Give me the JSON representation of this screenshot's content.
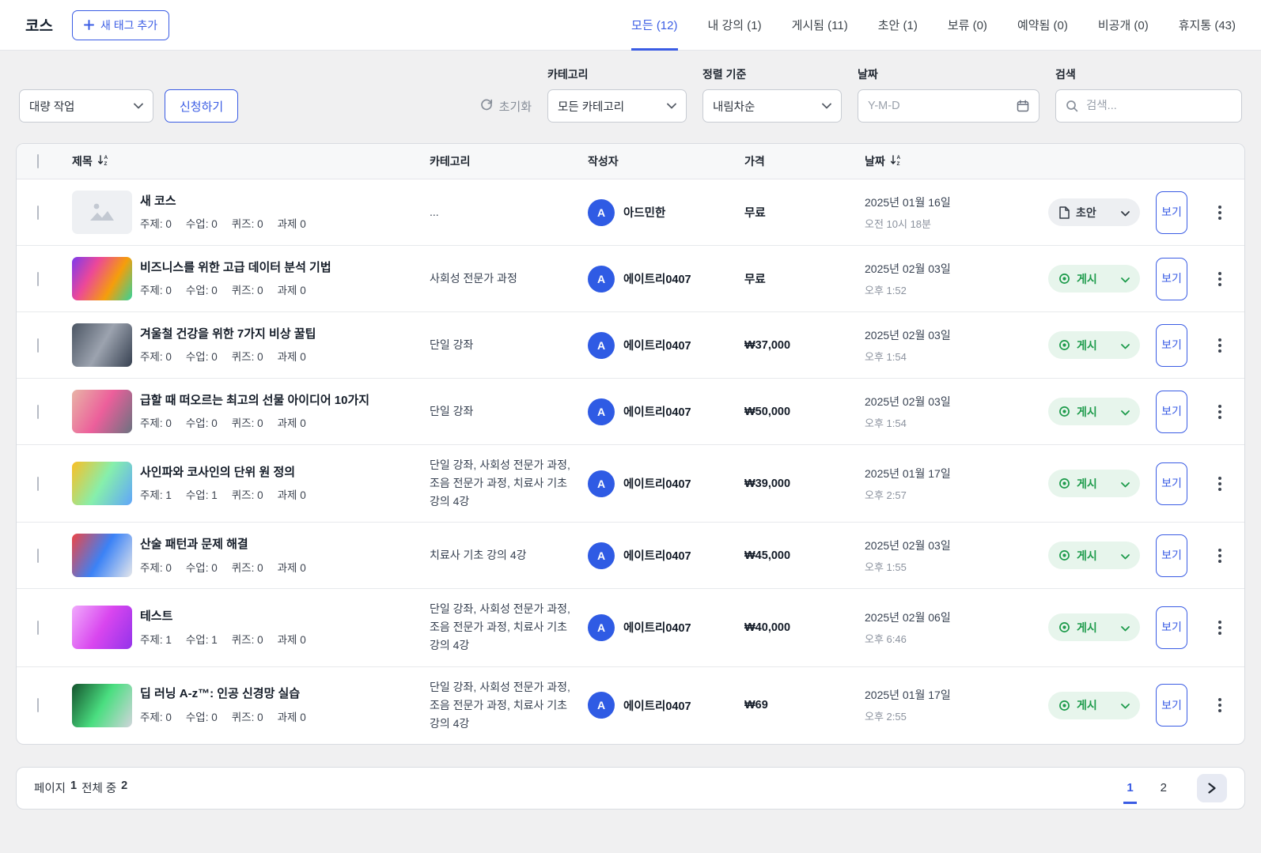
{
  "colors": {
    "accent": "#3a5ce4",
    "published_bg": "#e7f5ec",
    "published_text": "#1d9b4b",
    "draft_bg": "#edeff2",
    "draft_text": "#333a44",
    "avatar": "#2f5be4"
  },
  "header": {
    "title": "코스",
    "add_tag_button": "새 태그 추가",
    "tabs": [
      {
        "text": "모든 (12)",
        "active": true
      },
      {
        "text": "내 강의 (1)",
        "active": false
      },
      {
        "text": "게시됨 (11)",
        "active": false
      },
      {
        "text": "초안 (1)",
        "active": false
      },
      {
        "text": "보류 (0)",
        "active": false
      },
      {
        "text": "예약됨 (0)",
        "active": false
      },
      {
        "text": "비공개 (0)",
        "active": false
      },
      {
        "text": "휴지통 (43)",
        "active": false
      }
    ]
  },
  "filters": {
    "bulk_action_value": "대량 작업",
    "apply_button": "신청하기",
    "reset_button": "초기화",
    "category_label": "카테고리",
    "category_value": "모든 카테고리",
    "sort_label": "정렬 기준",
    "sort_value": "내림차순",
    "date_label": "날짜",
    "date_placeholder": "Y-M-D",
    "search_label": "검색",
    "search_placeholder": "검색..."
  },
  "table": {
    "columns": {
      "title": "제목",
      "category": "카테고리",
      "author": "작성자",
      "price": "가격",
      "date": "날짜"
    },
    "meta_labels": {
      "topic": "주제:",
      "lesson": "수업:",
      "quiz": "퀴즈:",
      "assignment": "과제"
    },
    "view_button": "보기",
    "rows": [
      {
        "title": "새 코스",
        "meta": {
          "topic": "0",
          "lesson": "0",
          "quiz": "0",
          "assignment": "0"
        },
        "category": "...",
        "author": {
          "initial": "A",
          "name": "아드민한"
        },
        "price": "무료",
        "date_main": "2025년 01월 16일",
        "date_sub": "오전 10시 18분",
        "status": {
          "type": "draft",
          "label": "초안"
        },
        "thumb": [],
        "placeholder": true
      },
      {
        "title": "비즈니스를 위한 고급 데이터 분석 기법",
        "meta": {
          "topic": "0",
          "lesson": "0",
          "quiz": "0",
          "assignment": "0"
        },
        "category": "사회성 전문가 과정",
        "author": {
          "initial": "A",
          "name": "에이트리0407"
        },
        "price": "무료",
        "date_main": "2025년 02월 03일",
        "date_sub": "오후 1:52",
        "status": {
          "type": "published",
          "label": "게시"
        },
        "thumb": [
          "#7c3aed",
          "#ec4899",
          "#f59e0b",
          "#34d399"
        ],
        "placeholder": false
      },
      {
        "title": "겨울철 건강을 위한 7가지 비상 꿀팁",
        "meta": {
          "topic": "0",
          "lesson": "0",
          "quiz": "0",
          "assignment": "0"
        },
        "category": "단일 강좌",
        "author": {
          "initial": "A",
          "name": "에이트리0407"
        },
        "price": "₩37,000",
        "date_main": "2025년 02월 03일",
        "date_sub": "오후 1:54",
        "status": {
          "type": "published",
          "label": "게시"
        },
        "thumb": [
          "#4b5563",
          "#9ca3af",
          "#374151"
        ],
        "placeholder": false
      },
      {
        "title": "급할 때 떠오르는 최고의 선물 아이디어 10가지",
        "meta": {
          "topic": "0",
          "lesson": "0",
          "quiz": "0",
          "assignment": "0"
        },
        "category": "단일 강좌",
        "author": {
          "initial": "A",
          "name": "에이트리0407"
        },
        "price": "₩50,000",
        "date_main": "2025년 02월 03일",
        "date_sub": "오후 1:54",
        "status": {
          "type": "published",
          "label": "게시"
        },
        "thumb": [
          "#e8b4a6",
          "#ec5f9b",
          "#6b7280"
        ],
        "placeholder": false
      },
      {
        "title": "사인파와 코사인의 단위 원 정의",
        "meta": {
          "topic": "1",
          "lesson": "1",
          "quiz": "0",
          "assignment": "0"
        },
        "category": "단일 강좌, 사회성 전문가 과정, 조음 전문가 과정, 치료사 기초 강의 4강",
        "author": {
          "initial": "A",
          "name": "에이트리0407"
        },
        "price": "₩39,000",
        "date_main": "2025년 01월 17일",
        "date_sub": "오후 2:57",
        "status": {
          "type": "published",
          "label": "게시"
        },
        "thumb": [
          "#fbbf24",
          "#86efac",
          "#60a5fa"
        ],
        "placeholder": false
      },
      {
        "title": "산술 패턴과 문제 해결",
        "meta": {
          "topic": "0",
          "lesson": "0",
          "quiz": "0",
          "assignment": "0"
        },
        "category": "치료사 기초 강의 4강",
        "author": {
          "initial": "A",
          "name": "에이트리0407"
        },
        "price": "₩45,000",
        "date_main": "2025년 02월 03일",
        "date_sub": "오후 1:55",
        "status": {
          "type": "published",
          "label": "게시"
        },
        "thumb": [
          "#ef4444",
          "#3b82f6",
          "#e5e7eb"
        ],
        "placeholder": false
      },
      {
        "title": "테스트",
        "meta": {
          "topic": "1",
          "lesson": "1",
          "quiz": "0",
          "assignment": "0"
        },
        "category": "단일 강좌, 사회성 전문가 과정, 조음 전문가 과정, 치료사 기초 강의 4강",
        "author": {
          "initial": "A",
          "name": "에이트리0407"
        },
        "price": "₩40,000",
        "date_main": "2025년 02월 06일",
        "date_sub": "오후 6:46",
        "status": {
          "type": "published",
          "label": "게시"
        },
        "thumb": [
          "#f0abfc",
          "#d946ef",
          "#9333ea"
        ],
        "placeholder": false
      },
      {
        "title": "딥 러닝 A-z™: 인공 신경망 실습",
        "meta": {
          "topic": "0",
          "lesson": "0",
          "quiz": "0",
          "assignment": "0"
        },
        "category": "단일 강좌, 사회성 전문가 과정, 조음 전문가 과정, 치료사 기초 강의 4강",
        "author": {
          "initial": "A",
          "name": "에이트리0407"
        },
        "price": "₩69",
        "date_main": "2025년 01월 17일",
        "date_sub": "오후 2:55",
        "status": {
          "type": "published",
          "label": "게시"
        },
        "thumb": [
          "#14532d",
          "#4ade80",
          "#d1d5db"
        ],
        "placeholder": false
      }
    ]
  },
  "pagination": {
    "prefix": "페이지",
    "current": "1",
    "middle": "전체 중",
    "total": "2",
    "pages": [
      {
        "num": "1",
        "active": true
      },
      {
        "num": "2",
        "active": false
      }
    ]
  }
}
